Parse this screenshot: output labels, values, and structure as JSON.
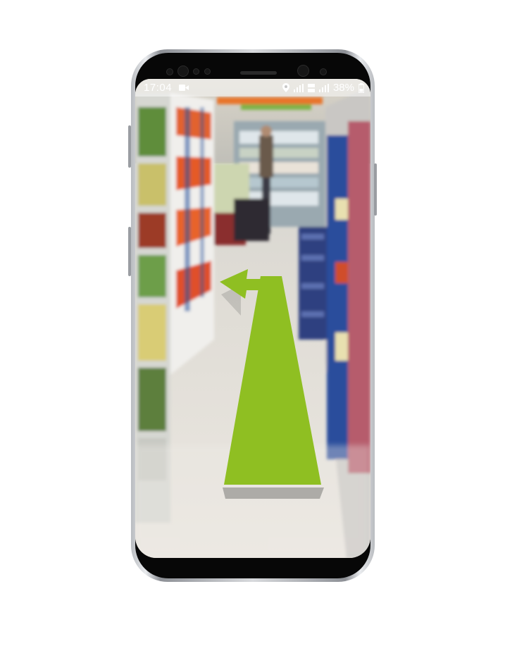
{
  "status_bar": {
    "time": "17:04",
    "battery_text": "38%",
    "icons": [
      "video-record-icon",
      "location-icon",
      "signal-icon",
      "lte-icon",
      "signal-icon",
      "battery-icon"
    ]
  },
  "ar_view": {
    "scene": "store-aisle-photo",
    "arrow_direction": "left-turn",
    "colors": {
      "arrow": "#8fbf22",
      "status_text": "#ffffff"
    }
  }
}
